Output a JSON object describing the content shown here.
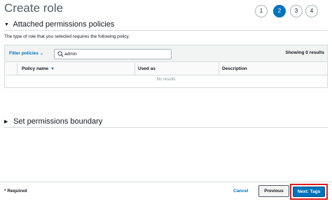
{
  "page": {
    "title": "Create role"
  },
  "steps": [
    {
      "label": "1",
      "active": false
    },
    {
      "label": "2",
      "active": true
    },
    {
      "label": "3",
      "active": false
    },
    {
      "label": "4",
      "active": false
    }
  ],
  "attached": {
    "heading": "Attached permissions policies",
    "description": "The type of role that you selected requires the following policy.",
    "filter_label": "Filter policies",
    "search_value": "admin",
    "showing": "Showing 0 results",
    "columns": [
      "Policy name",
      "Used as",
      "Description"
    ],
    "empty_text": "No results"
  },
  "boundary": {
    "heading": "Set permissions boundary"
  },
  "footer": {
    "required": "* Required",
    "cancel": "Cancel",
    "previous": "Previous",
    "next": "Next: Tags"
  },
  "colors": {
    "accent": "#0073bb",
    "highlight": "#e01b1b"
  }
}
